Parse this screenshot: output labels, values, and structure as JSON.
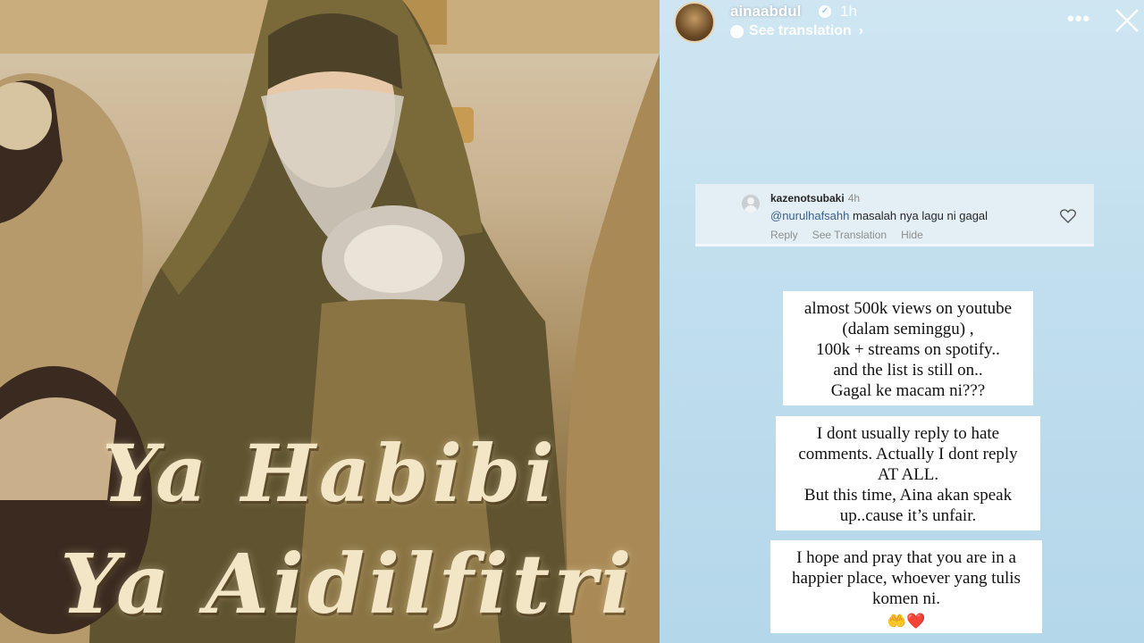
{
  "poster": {
    "title_line1": "Ya Habibi",
    "title_line2": "Ya Aidilfitri"
  },
  "story": {
    "header": {
      "username": "ainaabdul",
      "verified": true,
      "time_ago": "1h",
      "see_translation": "See translation",
      "more_icon": "more-dots-icon",
      "close_icon": "close-icon"
    },
    "comment": {
      "username": "kazenotsubaki",
      "time": "4h",
      "mention": "@nurulhafsahh",
      "text": "masalah nya lagu ni gagal",
      "actions": {
        "reply": "Reply",
        "see_translation": "See Translation",
        "hide": "Hide"
      }
    },
    "stickers": [
      {
        "lines": [
          "almost 500k views on youtube",
          "(dalam seminggu) ,",
          "100k + streams on spotify..",
          "and the list is still on..",
          "Gagal ke macam ni???"
        ]
      },
      {
        "lines": [
          "I dont usually reply to hate",
          "comments. Actually I dont reply",
          "AT ALL.",
          "But this time, Aina akan speak",
          "up..cause it’s unfair."
        ]
      },
      {
        "lines": [
          "I hope and pray that you are in a",
          "happier place, whoever yang tulis",
          "komen ni."
        ],
        "emojis": [
          "🤲",
          "❤️"
        ]
      }
    ],
    "colors": {
      "background_top": "#cfe6f2",
      "background_bottom": "#b4d7ea",
      "sticker_bg": "#ffffff",
      "comment_bg": "#e3eef5"
    }
  }
}
